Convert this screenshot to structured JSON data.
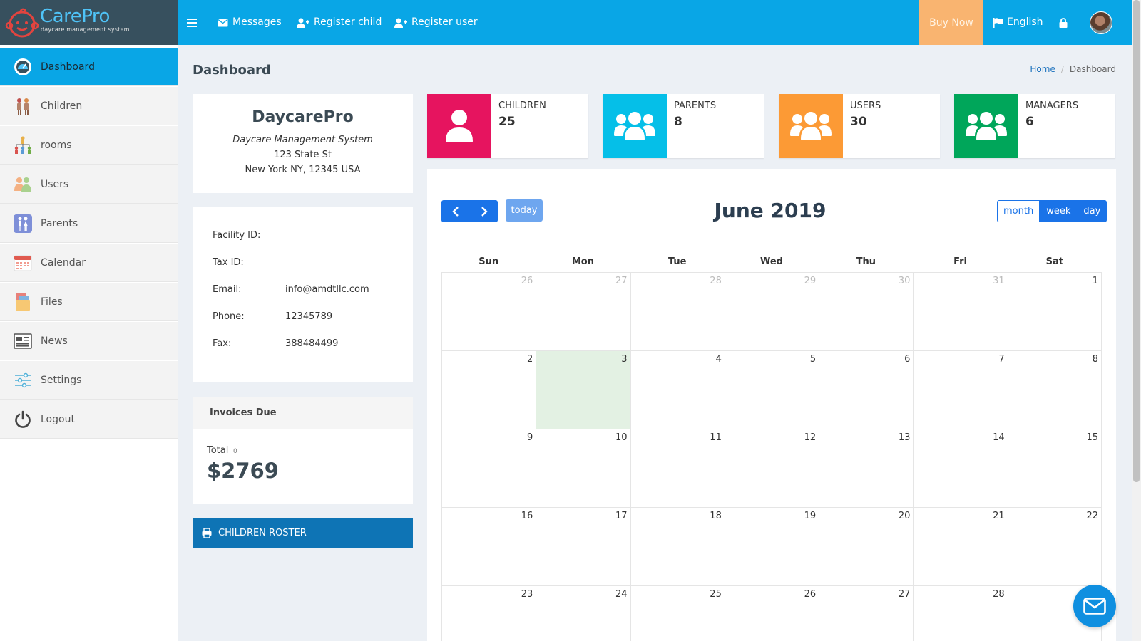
{
  "app": {
    "logo_title": "CarePro",
    "logo_subtitle": "daycare management system"
  },
  "topnav": {
    "messages": "Messages",
    "register_child": "Register child",
    "register_user": "Register user",
    "buy_now": "Buy Now",
    "language": "English"
  },
  "sidebar": {
    "items": [
      {
        "label": "Dashboard",
        "icon": "dashboard-gauge-icon",
        "active": true
      },
      {
        "label": "Children",
        "icon": "children-icon"
      },
      {
        "label": "rooms",
        "icon": "rooms-hierarchy-icon"
      },
      {
        "label": "Users",
        "icon": "users-icon"
      },
      {
        "label": "Parents",
        "icon": "parents-icon"
      },
      {
        "label": "Calendar",
        "icon": "calendar-icon"
      },
      {
        "label": "Files",
        "icon": "files-icon"
      },
      {
        "label": "News",
        "icon": "news-icon"
      },
      {
        "label": "Settings",
        "icon": "settings-sliders-icon"
      },
      {
        "label": "Logout",
        "icon": "power-icon"
      }
    ]
  },
  "page": {
    "title": "Dashboard",
    "breadcrumb": [
      "Home",
      "Dashboard"
    ]
  },
  "facility": {
    "name": "DaycarePro",
    "tagline": "Daycare Management System",
    "street": "123 State St",
    "city": "New York NY, 12345 USA",
    "fields": [
      {
        "key": "Facility ID:",
        "value": ""
      },
      {
        "key": "Tax ID:",
        "value": ""
      },
      {
        "key": "Email:",
        "value": "info@amdtllc.com"
      },
      {
        "key": "Phone:",
        "value": "12345789"
      },
      {
        "key": "Fax:",
        "value": "388484499"
      }
    ]
  },
  "invoices": {
    "title": "Invoices Due",
    "total_label": "Total",
    "count": "0",
    "amount": "$2769"
  },
  "roster_button": "CHILDREN ROSTER",
  "stats": [
    {
      "label": "CHILDREN",
      "value": "25",
      "color": "#e6145f",
      "icon": "user-icon"
    },
    {
      "label": "PARENTS",
      "value": "8",
      "color": "#05bfe8",
      "icon": "users-group-icon"
    },
    {
      "label": "USERS",
      "value": "30",
      "color": "#fc9a35",
      "icon": "users-group-icon"
    },
    {
      "label": "MANAGERS",
      "value": "6",
      "color": "#00a65a",
      "icon": "users-group-icon"
    }
  ],
  "calendar": {
    "title": "June 2019",
    "today_label": "today",
    "views": [
      "month",
      "week",
      "day"
    ],
    "selected_view": "month",
    "days_of_week": [
      "Sun",
      "Mon",
      "Tue",
      "Wed",
      "Thu",
      "Fri",
      "Sat"
    ],
    "weeks": [
      [
        {
          "d": "26",
          "other": true
        },
        {
          "d": "27",
          "other": true
        },
        {
          "d": "28",
          "other": true
        },
        {
          "d": "29",
          "other": true
        },
        {
          "d": "30",
          "other": true
        },
        {
          "d": "31",
          "other": true
        },
        {
          "d": "1"
        }
      ],
      [
        {
          "d": "2"
        },
        {
          "d": "3",
          "today": true
        },
        {
          "d": "4"
        },
        {
          "d": "5"
        },
        {
          "d": "6"
        },
        {
          "d": "7"
        },
        {
          "d": "8"
        }
      ],
      [
        {
          "d": "9"
        },
        {
          "d": "10"
        },
        {
          "d": "11"
        },
        {
          "d": "12"
        },
        {
          "d": "13"
        },
        {
          "d": "14"
        },
        {
          "d": "15"
        }
      ],
      [
        {
          "d": "16"
        },
        {
          "d": "17"
        },
        {
          "d": "18"
        },
        {
          "d": "19"
        },
        {
          "d": "20"
        },
        {
          "d": "21"
        },
        {
          "d": "22"
        }
      ],
      [
        {
          "d": "23"
        },
        {
          "d": "24"
        },
        {
          "d": "25"
        },
        {
          "d": "26"
        },
        {
          "d": "27"
        },
        {
          "d": "28"
        },
        {
          "d": ""
        }
      ]
    ]
  }
}
